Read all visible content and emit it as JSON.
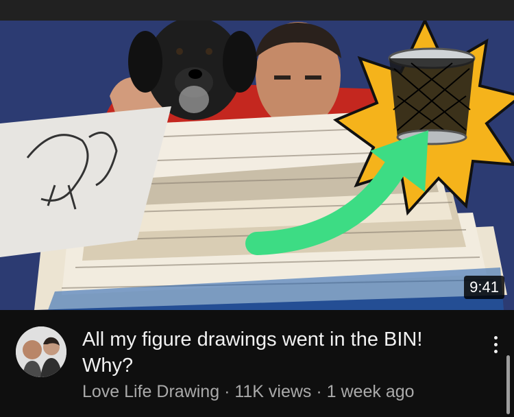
{
  "video": {
    "duration": "9:41",
    "title": "All my figure drawings went in the BIN! Why?",
    "channel": "Love Life Drawing",
    "views": "11K views",
    "age": "1 week ago",
    "separator": " · "
  },
  "icons": {
    "more": "kebab-vertical-icon",
    "bin": "trash-bin-icon"
  },
  "colors": {
    "background": "#0f0f0f",
    "thumbnail_bg": "#2b3a6e",
    "starburst": "#f5b31b",
    "arrow": "#3ddc84",
    "title_text": "#f1f1f1",
    "secondary_text": "#aaaaaa"
  }
}
